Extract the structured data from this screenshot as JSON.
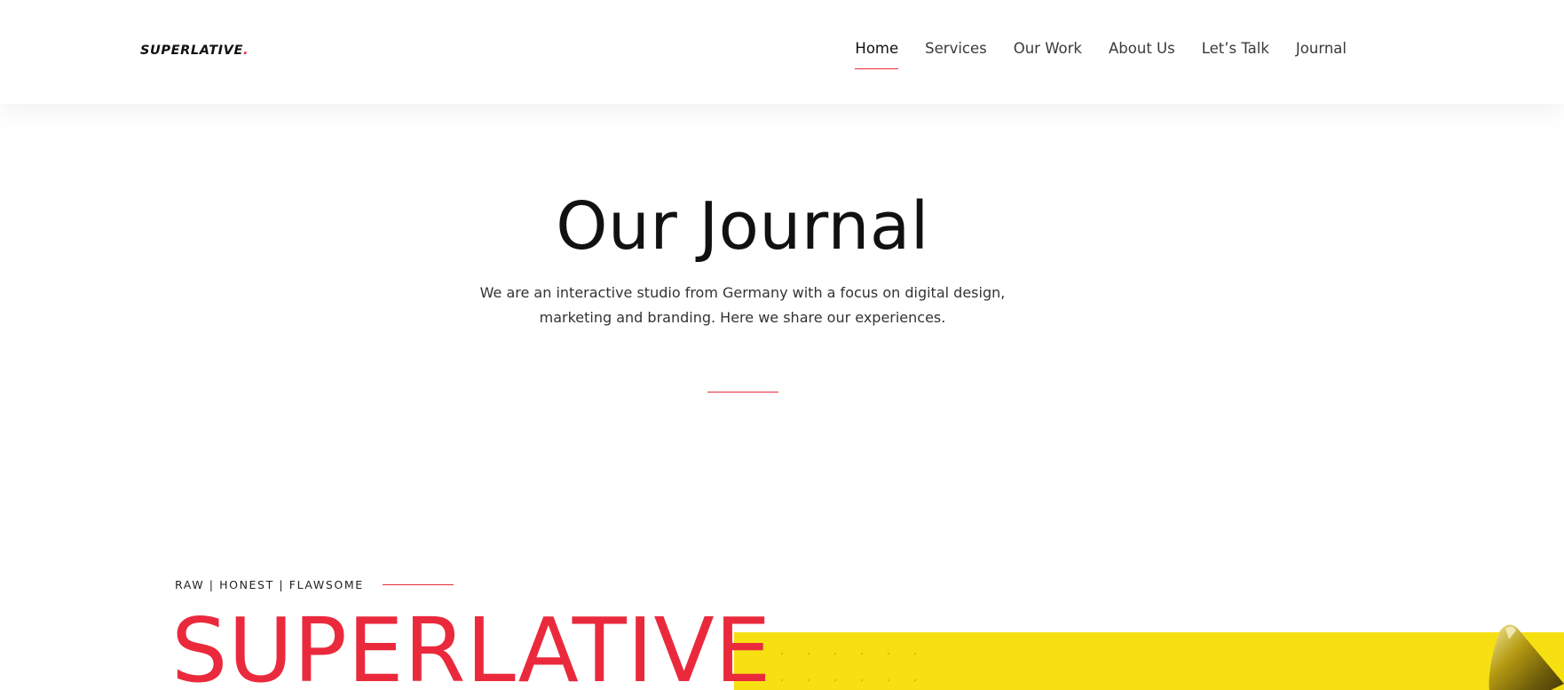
{
  "header": {
    "logo_text": "SUPERLATIVE",
    "logo_dot": ".",
    "nav": [
      {
        "label": "Home",
        "active": true
      },
      {
        "label": "Services"
      },
      {
        "label": "Our Work"
      },
      {
        "label": "About Us"
      },
      {
        "label": "Let’s Talk"
      },
      {
        "label": "Journal"
      }
    ]
  },
  "hero": {
    "title": "Our Journal",
    "subtitle_line1": "We are an interactive studio from Germany with a focus on digital design,",
    "subtitle_line2": "marketing and branding. Here we share our experiences."
  },
  "feature": {
    "tagline": "RAW | HONEST | FLAWSOME",
    "headline": "SUPERLATIVE"
  },
  "colors": {
    "accent": "#ea2a3c",
    "panel": "#f7e012",
    "text": "#111111"
  }
}
